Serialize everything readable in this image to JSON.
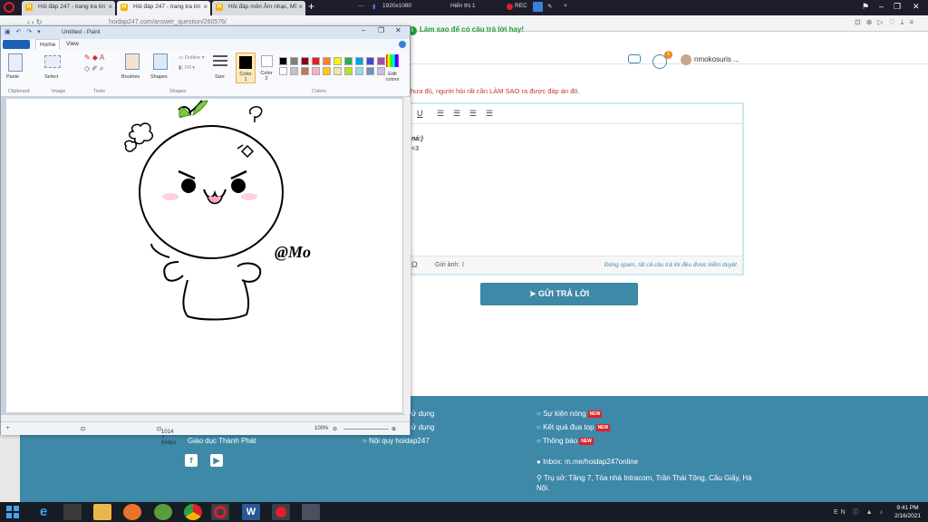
{
  "browser": {
    "tabs": [
      {
        "label": "Hỏi đáp 247 - trang tra lời",
        "active": false
      },
      {
        "label": "Hỏi đáp 247 - trang tra lời",
        "active": true
      },
      {
        "label": "Hỏi đáp môn Âm nhạc, Mĩ",
        "active": false
      }
    ],
    "new_tab": "+",
    "url": "hoidap247.com/answer_question/260576/",
    "recorder": {
      "resolution": "1920x1080",
      "display": "Hiển thị 1",
      "rec_label": "REC"
    }
  },
  "site": {
    "tip": "Làm sao để có câu trả lời hay!",
    "notification_count": "1",
    "username": "nmokosuris ...",
    "notice": "hưa đủ, người hỏi rất cần LÀM SAO ra được đáp án đó.",
    "editor": {
      "toolbar_underline": "U",
      "content_line1": "nả:)",
      "content_line2": "<3",
      "attach_label": "Gửi ảnh:",
      "warning": "Đừng spam, tất cả câu trả lời đều được kiểm duyệt"
    },
    "submit_label": "GỬI TRẢ LỜI",
    "footer": {
      "col1": [
        "ử dụng",
        "ử dụng",
        "Nội quy hoidap247"
      ],
      "company": "Giáo dục Thành Phát",
      "col2": [
        {
          "label": "Sự kiện nóng",
          "badge": "NEW"
        },
        {
          "label": "Kết quả đua top",
          "badge": "NEW"
        },
        {
          "label": "Thông báo",
          "badge": "NEW"
        }
      ],
      "inbox": "Inbox: m.me/hoidap247online",
      "address": "Trụ sở: Tầng 7, Tòa nhà Intracom, Trần Thái Tông, Cầu Giấy, Hà Nội."
    }
  },
  "paint": {
    "title": "Untitled - Paint",
    "menu": {
      "home": "Home",
      "view": "View"
    },
    "ribbon": {
      "paste": "Paste",
      "select": "Select",
      "brushes": "Brushes",
      "shapes": "Shapes",
      "outline": "Outline",
      "fill": "Fill",
      "size": "Size",
      "color1": "Color 1",
      "color2": "Color 2",
      "edit_colors": "Edit colors",
      "groups": {
        "clipboard": "Clipboard",
        "image": "Image",
        "tools": "Tools",
        "shapes": "Shapes",
        "colors": "Colors"
      }
    },
    "palette": [
      "#000000",
      "#7f7f7f",
      "#880015",
      "#ed1c24",
      "#ff7f27",
      "#fff200",
      "#22b14c",
      "#00a2e8",
      "#3f48cc",
      "#a349a4",
      "#ffffff",
      "#c3c3c3",
      "#b97a57",
      "#ffaec9",
      "#ffc90e",
      "#efe4b0",
      "#b5e61d",
      "#99d9ea",
      "#7092be",
      "#c8bfe7"
    ],
    "canvas_signature": "@Mo",
    "status": {
      "size": "1014 × 848px",
      "zoom": "100%"
    }
  },
  "taskbar": {
    "time": "9:41 PM",
    "date": "2/16/2021"
  }
}
